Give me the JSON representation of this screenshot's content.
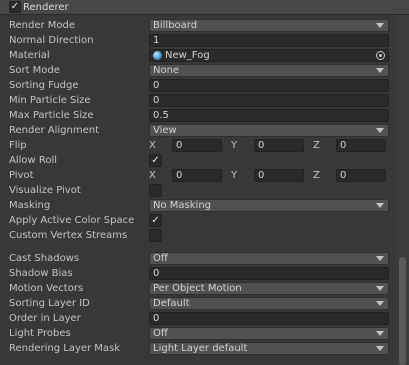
{
  "section": {
    "title": "Renderer",
    "enabled": true,
    "check_glyph": "✓"
  },
  "rows": {
    "render_mode": {
      "label": "Render Mode",
      "value": "Billboard"
    },
    "normal_direction": {
      "label": "Normal Direction",
      "value": "1"
    },
    "material": {
      "label": "Material",
      "value": "New_Fog"
    },
    "sort_mode": {
      "label": "Sort Mode",
      "value": "None"
    },
    "sorting_fudge": {
      "label": "Sorting Fudge",
      "value": "0"
    },
    "min_particle_size": {
      "label": "Min Particle Size",
      "value": "0"
    },
    "max_particle_size": {
      "label": "Max Particle Size",
      "value": "0.5"
    },
    "render_alignment": {
      "label": "Render Alignment",
      "value": "View"
    },
    "flip": {
      "label": "Flip",
      "x_label": "X",
      "x": "0",
      "y_label": "Y",
      "y": "0",
      "z_label": "Z",
      "z": "0"
    },
    "allow_roll": {
      "label": "Allow Roll",
      "checked": true,
      "glyph": "✓"
    },
    "pivot": {
      "label": "Pivot",
      "x_label": "X",
      "x": "0",
      "y_label": "Y",
      "y": "0",
      "z_label": "Z",
      "z": "0"
    },
    "visualize_pivot": {
      "label": "Visualize Pivot",
      "checked": false,
      "glyph": ""
    },
    "masking": {
      "label": "Masking",
      "value": "No Masking"
    },
    "apply_active_color_space": {
      "label": "Apply Active Color Space",
      "checked": true,
      "glyph": "✓"
    },
    "custom_vertex_streams": {
      "label": "Custom Vertex Streams",
      "checked": false,
      "glyph": ""
    },
    "cast_shadows": {
      "label": "Cast Shadows",
      "value": "Off"
    },
    "shadow_bias": {
      "label": "Shadow Bias",
      "value": "0"
    },
    "motion_vectors": {
      "label": "Motion Vectors",
      "value": "Per Object Motion"
    },
    "sorting_layer_id": {
      "label": "Sorting Layer ID",
      "value": "Default"
    },
    "order_in_layer": {
      "label": "Order in Layer",
      "value": "0"
    },
    "light_probes": {
      "label": "Light Probes",
      "value": "Off"
    },
    "rendering_layer_mask": {
      "label": "Rendering Layer Mask",
      "value": "Light Layer default"
    }
  },
  "icons": {
    "material": "sphere-material-icon",
    "picker": "object-picker-icon",
    "dropdown": "chevron-down-icon"
  },
  "colors": {
    "background": "#383838",
    "field": "#2a2a2a",
    "dropdown": "#515151",
    "header": "#474747"
  }
}
